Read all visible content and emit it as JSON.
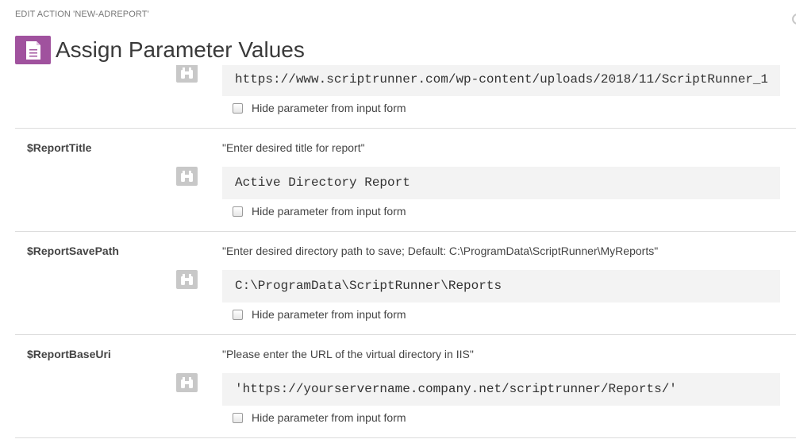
{
  "header": {
    "breadcrumb": "EDIT ACTION 'NEW-ADREPORT'",
    "title": "Assign Parameter Values",
    "icon": "document-icon",
    "accent_color": "#a0529e"
  },
  "parameters": [
    {
      "name": "",
      "description": "",
      "value": "https://www.scriptrunner.com/wp-content/uploads/2018/11/ScriptRunner_1",
      "hide_label": "Hide parameter from input form",
      "hide_checked": false
    },
    {
      "name": "$ReportTitle",
      "description": "\"Enter desired title for report\"",
      "value": "Active Directory Report",
      "hide_label": "Hide parameter from input form",
      "hide_checked": false
    },
    {
      "name": "$ReportSavePath",
      "description": "\"Enter desired directory path to save; Default: C:\\ProgramData\\ScriptRunner\\MyReports\"",
      "value": "C:\\ProgramData\\ScriptRunner\\Reports",
      "hide_label": "Hide parameter from input form",
      "hide_checked": false
    },
    {
      "name": "$ReportBaseUri",
      "description": "\"Please enter the URL of the virtual directory in IIS\"",
      "value": "'https://yourservername.company.net/scriptrunner/Reports/'",
      "hide_label": "Hide parameter from input form",
      "hide_checked": false
    }
  ],
  "icons": {
    "lookup": "binoculars-icon"
  }
}
